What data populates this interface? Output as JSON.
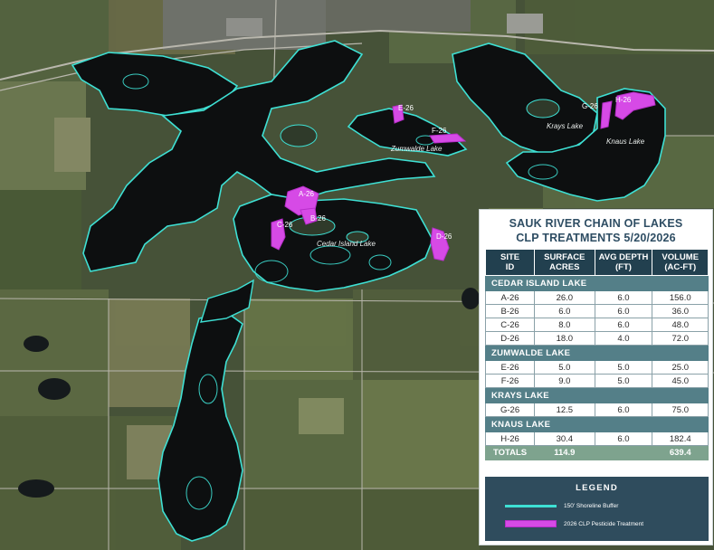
{
  "map": {
    "colors": {
      "water": "#0d0f10",
      "buffer": "#3ee0d4",
      "treatment": "#d64ae6",
      "road": "#b9b7ad"
    },
    "lake_labels": {
      "zumwalde": "Zumwalde Lake",
      "krays": "Krays Lake",
      "knaus": "Knaus Lake",
      "cedar": "Cedar Island Lake"
    },
    "site_labels": {
      "a": "A-26",
      "b": "B-26",
      "c": "C-26",
      "d": "D-26",
      "e": "E-26",
      "f": "F-26",
      "g": "G-26",
      "h": "H-26"
    }
  },
  "panel": {
    "title_line1": "SAUK RIVER CHAIN OF LAKES",
    "title_line2": "CLP TREATMENTS 5/20/2026",
    "headers": {
      "site_l1": "SITE",
      "site_l2": "ID",
      "area_l1": "SURFACE",
      "area_l2": "ACRES",
      "depth_l1": "AVG DEPTH",
      "depth_l2": "(FT)",
      "volume_l1": "VOLUME",
      "volume_l2": "(AC-FT)"
    },
    "sections": [
      {
        "name": "CEDAR ISLAND LAKE",
        "rows": [
          {
            "id": "A-26",
            "acres": "26.0",
            "depth": "6.0",
            "volume": "156.0"
          },
          {
            "id": "B-26",
            "acres": "6.0",
            "depth": "6.0",
            "volume": "36.0"
          },
          {
            "id": "C-26",
            "acres": "8.0",
            "depth": "6.0",
            "volume": "48.0"
          },
          {
            "id": "D-26",
            "acres": "18.0",
            "depth": "4.0",
            "volume": "72.0"
          }
        ]
      },
      {
        "name": "ZUMWALDE LAKE",
        "rows": [
          {
            "id": "E-26",
            "acres": "5.0",
            "depth": "5.0",
            "volume": "25.0"
          },
          {
            "id": "F-26",
            "acres": "9.0",
            "depth": "5.0",
            "volume": "45.0"
          }
        ]
      },
      {
        "name": "KRAYS LAKE",
        "rows": [
          {
            "id": "G-26",
            "acres": "12.5",
            "depth": "6.0",
            "volume": "75.0"
          }
        ]
      },
      {
        "name": "KNAUS LAKE",
        "rows": [
          {
            "id": "H-26",
            "acres": "30.4",
            "depth": "6.0",
            "volume": "182.4"
          }
        ]
      }
    ],
    "totals": {
      "label": "TOTALS",
      "acres": "114.9",
      "depth": "",
      "volume": "639.4"
    },
    "legend": {
      "title": "LEGEND",
      "buffer_label": "150' Shoreline Buffer",
      "treatment_label": "2026 CLP Pesticide Treatment"
    }
  }
}
